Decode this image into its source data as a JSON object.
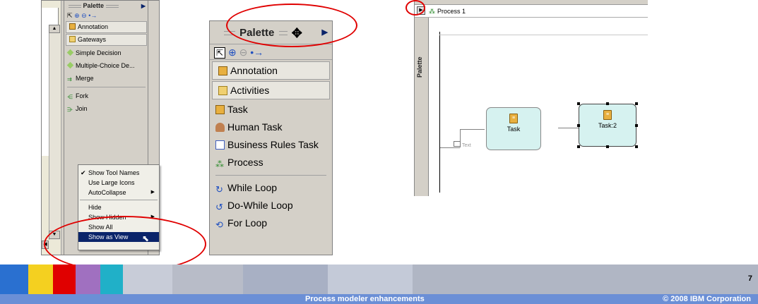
{
  "colors": {
    "highlight": "#e00000",
    "footer_bar": "#6b8fd6",
    "menu_selection": "#0a246a",
    "task_fill": "#d6f2f0"
  },
  "panel_small": {
    "palette_title": "Palette",
    "items": [
      {
        "label": "Annotation",
        "icon": "annotation-icon"
      },
      {
        "label": "Gateways",
        "icon": "folder-icon"
      },
      {
        "label": "Simple Decision",
        "icon": "decision-icon"
      },
      {
        "label": "Multiple-Choice De...",
        "icon": "decision-icon"
      },
      {
        "label": "Merge",
        "icon": "merge-icon"
      },
      {
        "label": "Fork",
        "icon": "fork-icon"
      },
      {
        "label": "Join",
        "icon": "join-icon"
      }
    ],
    "context_menu": {
      "items": [
        {
          "label": "Show Tool Names",
          "checked": true
        },
        {
          "label": "Use Large Icons"
        },
        {
          "label": "AutoCollapse",
          "submenu": true
        },
        {
          "label": "Hide"
        },
        {
          "label": "Show Hidden",
          "submenu": true
        },
        {
          "label": "Show All"
        },
        {
          "label": "Show as View",
          "selected": true
        }
      ]
    }
  },
  "panel_large": {
    "palette_title": "Palette",
    "items": [
      {
        "label": "Annotation",
        "icon": "annotation-icon"
      },
      {
        "label": "Activities",
        "icon": "folder-open-icon"
      },
      {
        "label": "Task",
        "icon": "task-icon"
      },
      {
        "label": "Human Task",
        "icon": "human-task-icon"
      },
      {
        "label": "Business Rules Task",
        "icon": "business-rules-icon"
      },
      {
        "label": "Process",
        "icon": "process-icon"
      },
      {
        "label": "While Loop",
        "icon": "while-loop-icon"
      },
      {
        "label": "Do-While Loop",
        "icon": "do-while-loop-icon"
      },
      {
        "label": "For Loop",
        "icon": "for-loop-icon"
      }
    ]
  },
  "panel_editor": {
    "tab_label": "Process 1",
    "sidebar_label": "Palette",
    "text_annotation": "Text",
    "node1_label": "Task",
    "node2_label": "Task:2"
  },
  "footer": {
    "title": "Process modeler enhancements",
    "copyright": "© 2008 IBM Corporation",
    "page_number": "7"
  }
}
